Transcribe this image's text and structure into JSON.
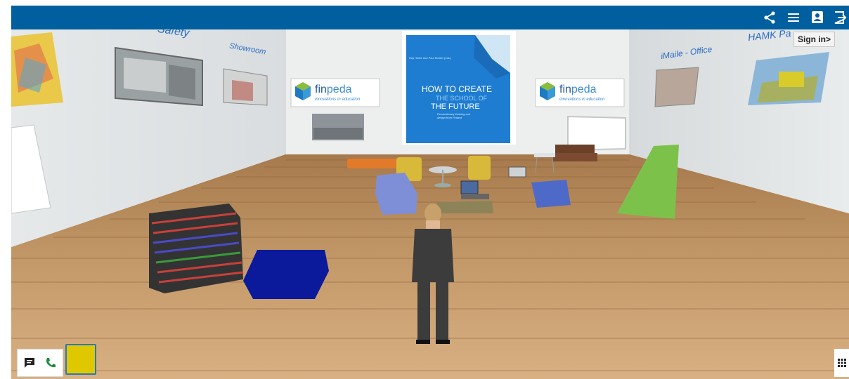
{
  "topbar": {
    "color": "#005f9e",
    "icons": [
      "share-icon",
      "menu-icon",
      "contact-card-icon",
      "exit-icon"
    ]
  },
  "tooltip": {
    "text": "Sign in>"
  },
  "wall_labels": {
    "safety": "Safety",
    "showroom": "Showroom",
    "imaile": "iMaile - Office",
    "hamk": "HAMK Pa"
  },
  "finpeda": {
    "name_fin": "fin",
    "name_peda": "peda",
    "tagline": "innovations in education"
  },
  "book": {
    "authors": "Hay Hettie and Paul Kiesler (eds.)",
    "title_line1": "HOW TO CREATE",
    "title_line2": "THE SCHOOL OF",
    "title_line3": "THE FUTURE",
    "subtitle_line1": "Revolutionary thinking and",
    "subtitle_line2": "design from Finland"
  },
  "bottom": {
    "chat_icon": "chat-icon",
    "phone_icon": "phone-icon",
    "swatch_color": "#e0c800",
    "grid_icon": "grid-icon"
  }
}
